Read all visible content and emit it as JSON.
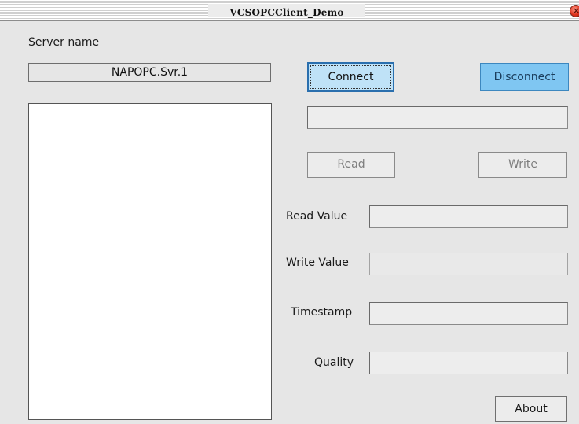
{
  "window": {
    "title": "VCSOPCClient_Demo",
    "close_glyph": "×"
  },
  "server": {
    "label": "Server name",
    "value": "NAPOPC.Svr.1"
  },
  "buttons": {
    "connect": "Connect",
    "disconnect": "Disconnect",
    "read": "Read",
    "write": "Write",
    "about": "About"
  },
  "fields": {
    "status": "",
    "read_value_label": "Read Value",
    "read_value": "",
    "write_value_label": "Write Value",
    "write_value": "",
    "timestamp_label": "Timestamp",
    "timestamp": "",
    "quality_label": "Quality",
    "quality": ""
  },
  "colors": {
    "disconnect_accent": "#7fc6f2",
    "connect_focus_border": "#2a6fae"
  }
}
